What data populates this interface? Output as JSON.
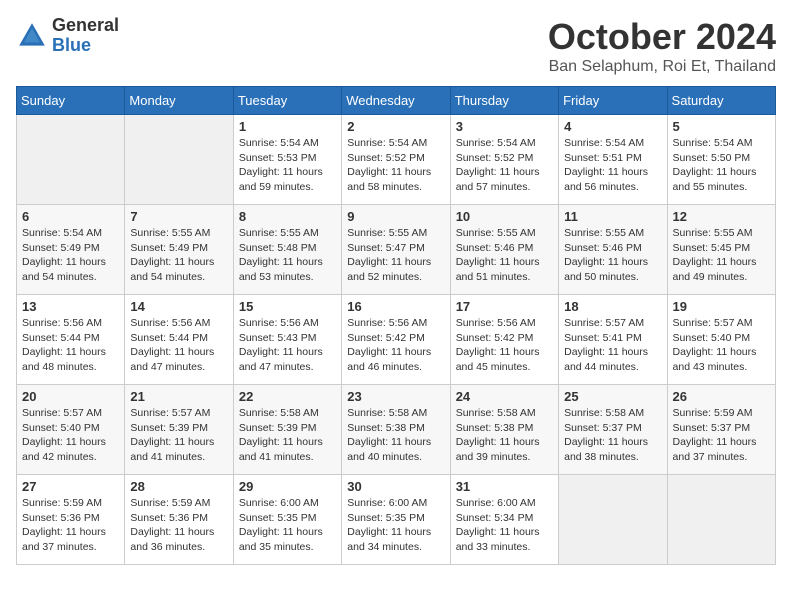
{
  "header": {
    "logo_general": "General",
    "logo_blue": "Blue",
    "month_title": "October 2024",
    "location": "Ban Selaphum, Roi Et, Thailand"
  },
  "days_of_week": [
    "Sunday",
    "Monday",
    "Tuesday",
    "Wednesday",
    "Thursday",
    "Friday",
    "Saturday"
  ],
  "weeks": [
    [
      {
        "day": "",
        "empty": true
      },
      {
        "day": "",
        "empty": true
      },
      {
        "day": "1",
        "sunrise": "Sunrise: 5:54 AM",
        "sunset": "Sunset: 5:53 PM",
        "daylight": "Daylight: 11 hours and 59 minutes."
      },
      {
        "day": "2",
        "sunrise": "Sunrise: 5:54 AM",
        "sunset": "Sunset: 5:52 PM",
        "daylight": "Daylight: 11 hours and 58 minutes."
      },
      {
        "day": "3",
        "sunrise": "Sunrise: 5:54 AM",
        "sunset": "Sunset: 5:52 PM",
        "daylight": "Daylight: 11 hours and 57 minutes."
      },
      {
        "day": "4",
        "sunrise": "Sunrise: 5:54 AM",
        "sunset": "Sunset: 5:51 PM",
        "daylight": "Daylight: 11 hours and 56 minutes."
      },
      {
        "day": "5",
        "sunrise": "Sunrise: 5:54 AM",
        "sunset": "Sunset: 5:50 PM",
        "daylight": "Daylight: 11 hours and 55 minutes."
      }
    ],
    [
      {
        "day": "6",
        "sunrise": "Sunrise: 5:54 AM",
        "sunset": "Sunset: 5:49 PM",
        "daylight": "Daylight: 11 hours and 54 minutes."
      },
      {
        "day": "7",
        "sunrise": "Sunrise: 5:55 AM",
        "sunset": "Sunset: 5:49 PM",
        "daylight": "Daylight: 11 hours and 54 minutes."
      },
      {
        "day": "8",
        "sunrise": "Sunrise: 5:55 AM",
        "sunset": "Sunset: 5:48 PM",
        "daylight": "Daylight: 11 hours and 53 minutes."
      },
      {
        "day": "9",
        "sunrise": "Sunrise: 5:55 AM",
        "sunset": "Sunset: 5:47 PM",
        "daylight": "Daylight: 11 hours and 52 minutes."
      },
      {
        "day": "10",
        "sunrise": "Sunrise: 5:55 AM",
        "sunset": "Sunset: 5:46 PM",
        "daylight": "Daylight: 11 hours and 51 minutes."
      },
      {
        "day": "11",
        "sunrise": "Sunrise: 5:55 AM",
        "sunset": "Sunset: 5:46 PM",
        "daylight": "Daylight: 11 hours and 50 minutes."
      },
      {
        "day": "12",
        "sunrise": "Sunrise: 5:55 AM",
        "sunset": "Sunset: 5:45 PM",
        "daylight": "Daylight: 11 hours and 49 minutes."
      }
    ],
    [
      {
        "day": "13",
        "sunrise": "Sunrise: 5:56 AM",
        "sunset": "Sunset: 5:44 PM",
        "daylight": "Daylight: 11 hours and 48 minutes."
      },
      {
        "day": "14",
        "sunrise": "Sunrise: 5:56 AM",
        "sunset": "Sunset: 5:44 PM",
        "daylight": "Daylight: 11 hours and 47 minutes."
      },
      {
        "day": "15",
        "sunrise": "Sunrise: 5:56 AM",
        "sunset": "Sunset: 5:43 PM",
        "daylight": "Daylight: 11 hours and 47 minutes."
      },
      {
        "day": "16",
        "sunrise": "Sunrise: 5:56 AM",
        "sunset": "Sunset: 5:42 PM",
        "daylight": "Daylight: 11 hours and 46 minutes."
      },
      {
        "day": "17",
        "sunrise": "Sunrise: 5:56 AM",
        "sunset": "Sunset: 5:42 PM",
        "daylight": "Daylight: 11 hours and 45 minutes."
      },
      {
        "day": "18",
        "sunrise": "Sunrise: 5:57 AM",
        "sunset": "Sunset: 5:41 PM",
        "daylight": "Daylight: 11 hours and 44 minutes."
      },
      {
        "day": "19",
        "sunrise": "Sunrise: 5:57 AM",
        "sunset": "Sunset: 5:40 PM",
        "daylight": "Daylight: 11 hours and 43 minutes."
      }
    ],
    [
      {
        "day": "20",
        "sunrise": "Sunrise: 5:57 AM",
        "sunset": "Sunset: 5:40 PM",
        "daylight": "Daylight: 11 hours and 42 minutes."
      },
      {
        "day": "21",
        "sunrise": "Sunrise: 5:57 AM",
        "sunset": "Sunset: 5:39 PM",
        "daylight": "Daylight: 11 hours and 41 minutes."
      },
      {
        "day": "22",
        "sunrise": "Sunrise: 5:58 AM",
        "sunset": "Sunset: 5:39 PM",
        "daylight": "Daylight: 11 hours and 41 minutes."
      },
      {
        "day": "23",
        "sunrise": "Sunrise: 5:58 AM",
        "sunset": "Sunset: 5:38 PM",
        "daylight": "Daylight: 11 hours and 40 minutes."
      },
      {
        "day": "24",
        "sunrise": "Sunrise: 5:58 AM",
        "sunset": "Sunset: 5:38 PM",
        "daylight": "Daylight: 11 hours and 39 minutes."
      },
      {
        "day": "25",
        "sunrise": "Sunrise: 5:58 AM",
        "sunset": "Sunset: 5:37 PM",
        "daylight": "Daylight: 11 hours and 38 minutes."
      },
      {
        "day": "26",
        "sunrise": "Sunrise: 5:59 AM",
        "sunset": "Sunset: 5:37 PM",
        "daylight": "Daylight: 11 hours and 37 minutes."
      }
    ],
    [
      {
        "day": "27",
        "sunrise": "Sunrise: 5:59 AM",
        "sunset": "Sunset: 5:36 PM",
        "daylight": "Daylight: 11 hours and 37 minutes."
      },
      {
        "day": "28",
        "sunrise": "Sunrise: 5:59 AM",
        "sunset": "Sunset: 5:36 PM",
        "daylight": "Daylight: 11 hours and 36 minutes."
      },
      {
        "day": "29",
        "sunrise": "Sunrise: 6:00 AM",
        "sunset": "Sunset: 5:35 PM",
        "daylight": "Daylight: 11 hours and 35 minutes."
      },
      {
        "day": "30",
        "sunrise": "Sunrise: 6:00 AM",
        "sunset": "Sunset: 5:35 PM",
        "daylight": "Daylight: 11 hours and 34 minutes."
      },
      {
        "day": "31",
        "sunrise": "Sunrise: 6:00 AM",
        "sunset": "Sunset: 5:34 PM",
        "daylight": "Daylight: 11 hours and 33 minutes."
      },
      {
        "day": "",
        "empty": true
      },
      {
        "day": "",
        "empty": true
      }
    ]
  ]
}
